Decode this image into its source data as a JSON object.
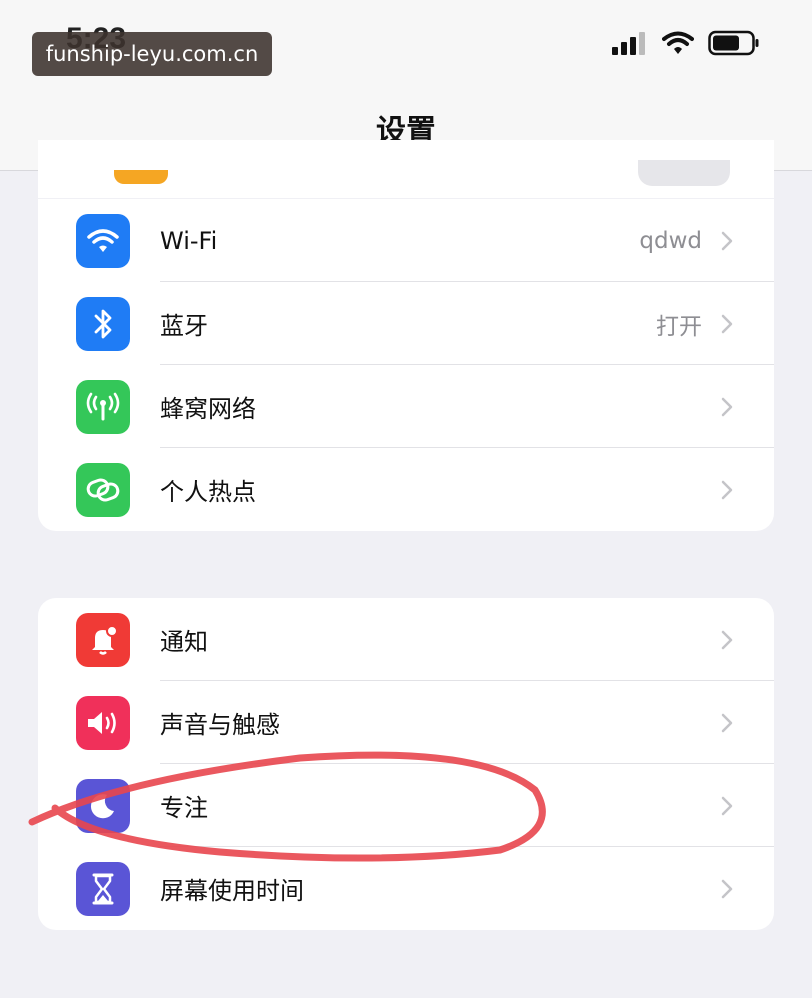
{
  "status_bar": {
    "time": "5:23",
    "watermark": "funship-leyu.com.cn"
  },
  "nav": {
    "title": "设置"
  },
  "group1": {
    "rows": [
      {
        "label": "Wi-Fi",
        "value": "qdwd",
        "icon": "wifi-icon",
        "color": "#1f7cf5"
      },
      {
        "label": "蓝牙",
        "value": "打开",
        "icon": "bluetooth-icon",
        "color": "#1f7cf5"
      },
      {
        "label": "蜂窝网络",
        "value": "",
        "icon": "cellular-icon",
        "color": "#34c759"
      },
      {
        "label": "个人热点",
        "value": "",
        "icon": "hotspot-icon",
        "color": "#34c759"
      }
    ]
  },
  "group2": {
    "rows": [
      {
        "label": "通知",
        "value": "",
        "icon": "bell-icon",
        "color": "#f03a36"
      },
      {
        "label": "声音与触感",
        "value": "",
        "icon": "speaker-icon",
        "color": "#f0305a"
      },
      {
        "label": "专注",
        "value": "",
        "icon": "moon-icon",
        "color": "#5a55d6"
      },
      {
        "label": "屏幕使用时间",
        "value": "",
        "icon": "hourglass-icon",
        "color": "#5a55d6"
      }
    ]
  },
  "colors": {
    "highlight_circle": "#e8464e"
  }
}
